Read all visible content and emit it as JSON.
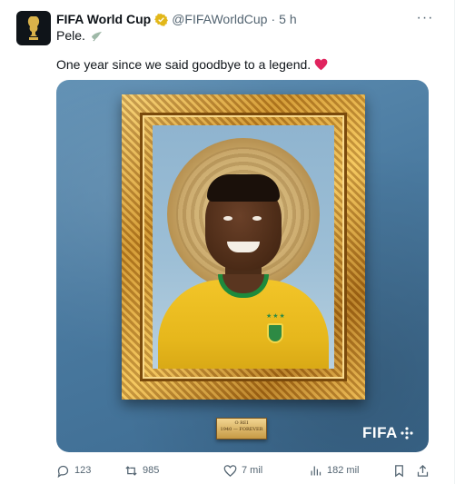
{
  "author": {
    "name": "FIFA World Cup",
    "handle": "@FIFAWorldCup",
    "time": "5 h",
    "separator": "·"
  },
  "text": {
    "line1": "Pele.",
    "line2": "One year since we said goodbye to a legend."
  },
  "media": {
    "plaque_line1": "O REI",
    "plaque_line2": "1940 — FOREVER",
    "brand": "FIFA"
  },
  "actions": {
    "replies": "123",
    "reposts": "985",
    "likes": "7 mil",
    "views": "182 mil"
  },
  "colors": {
    "accent": "#1d9bf0",
    "verified": "#e2b719",
    "heart": "#f91880",
    "muted": "#536471",
    "bg_blue": "#4a7aa0",
    "gold": "#c88a25"
  }
}
